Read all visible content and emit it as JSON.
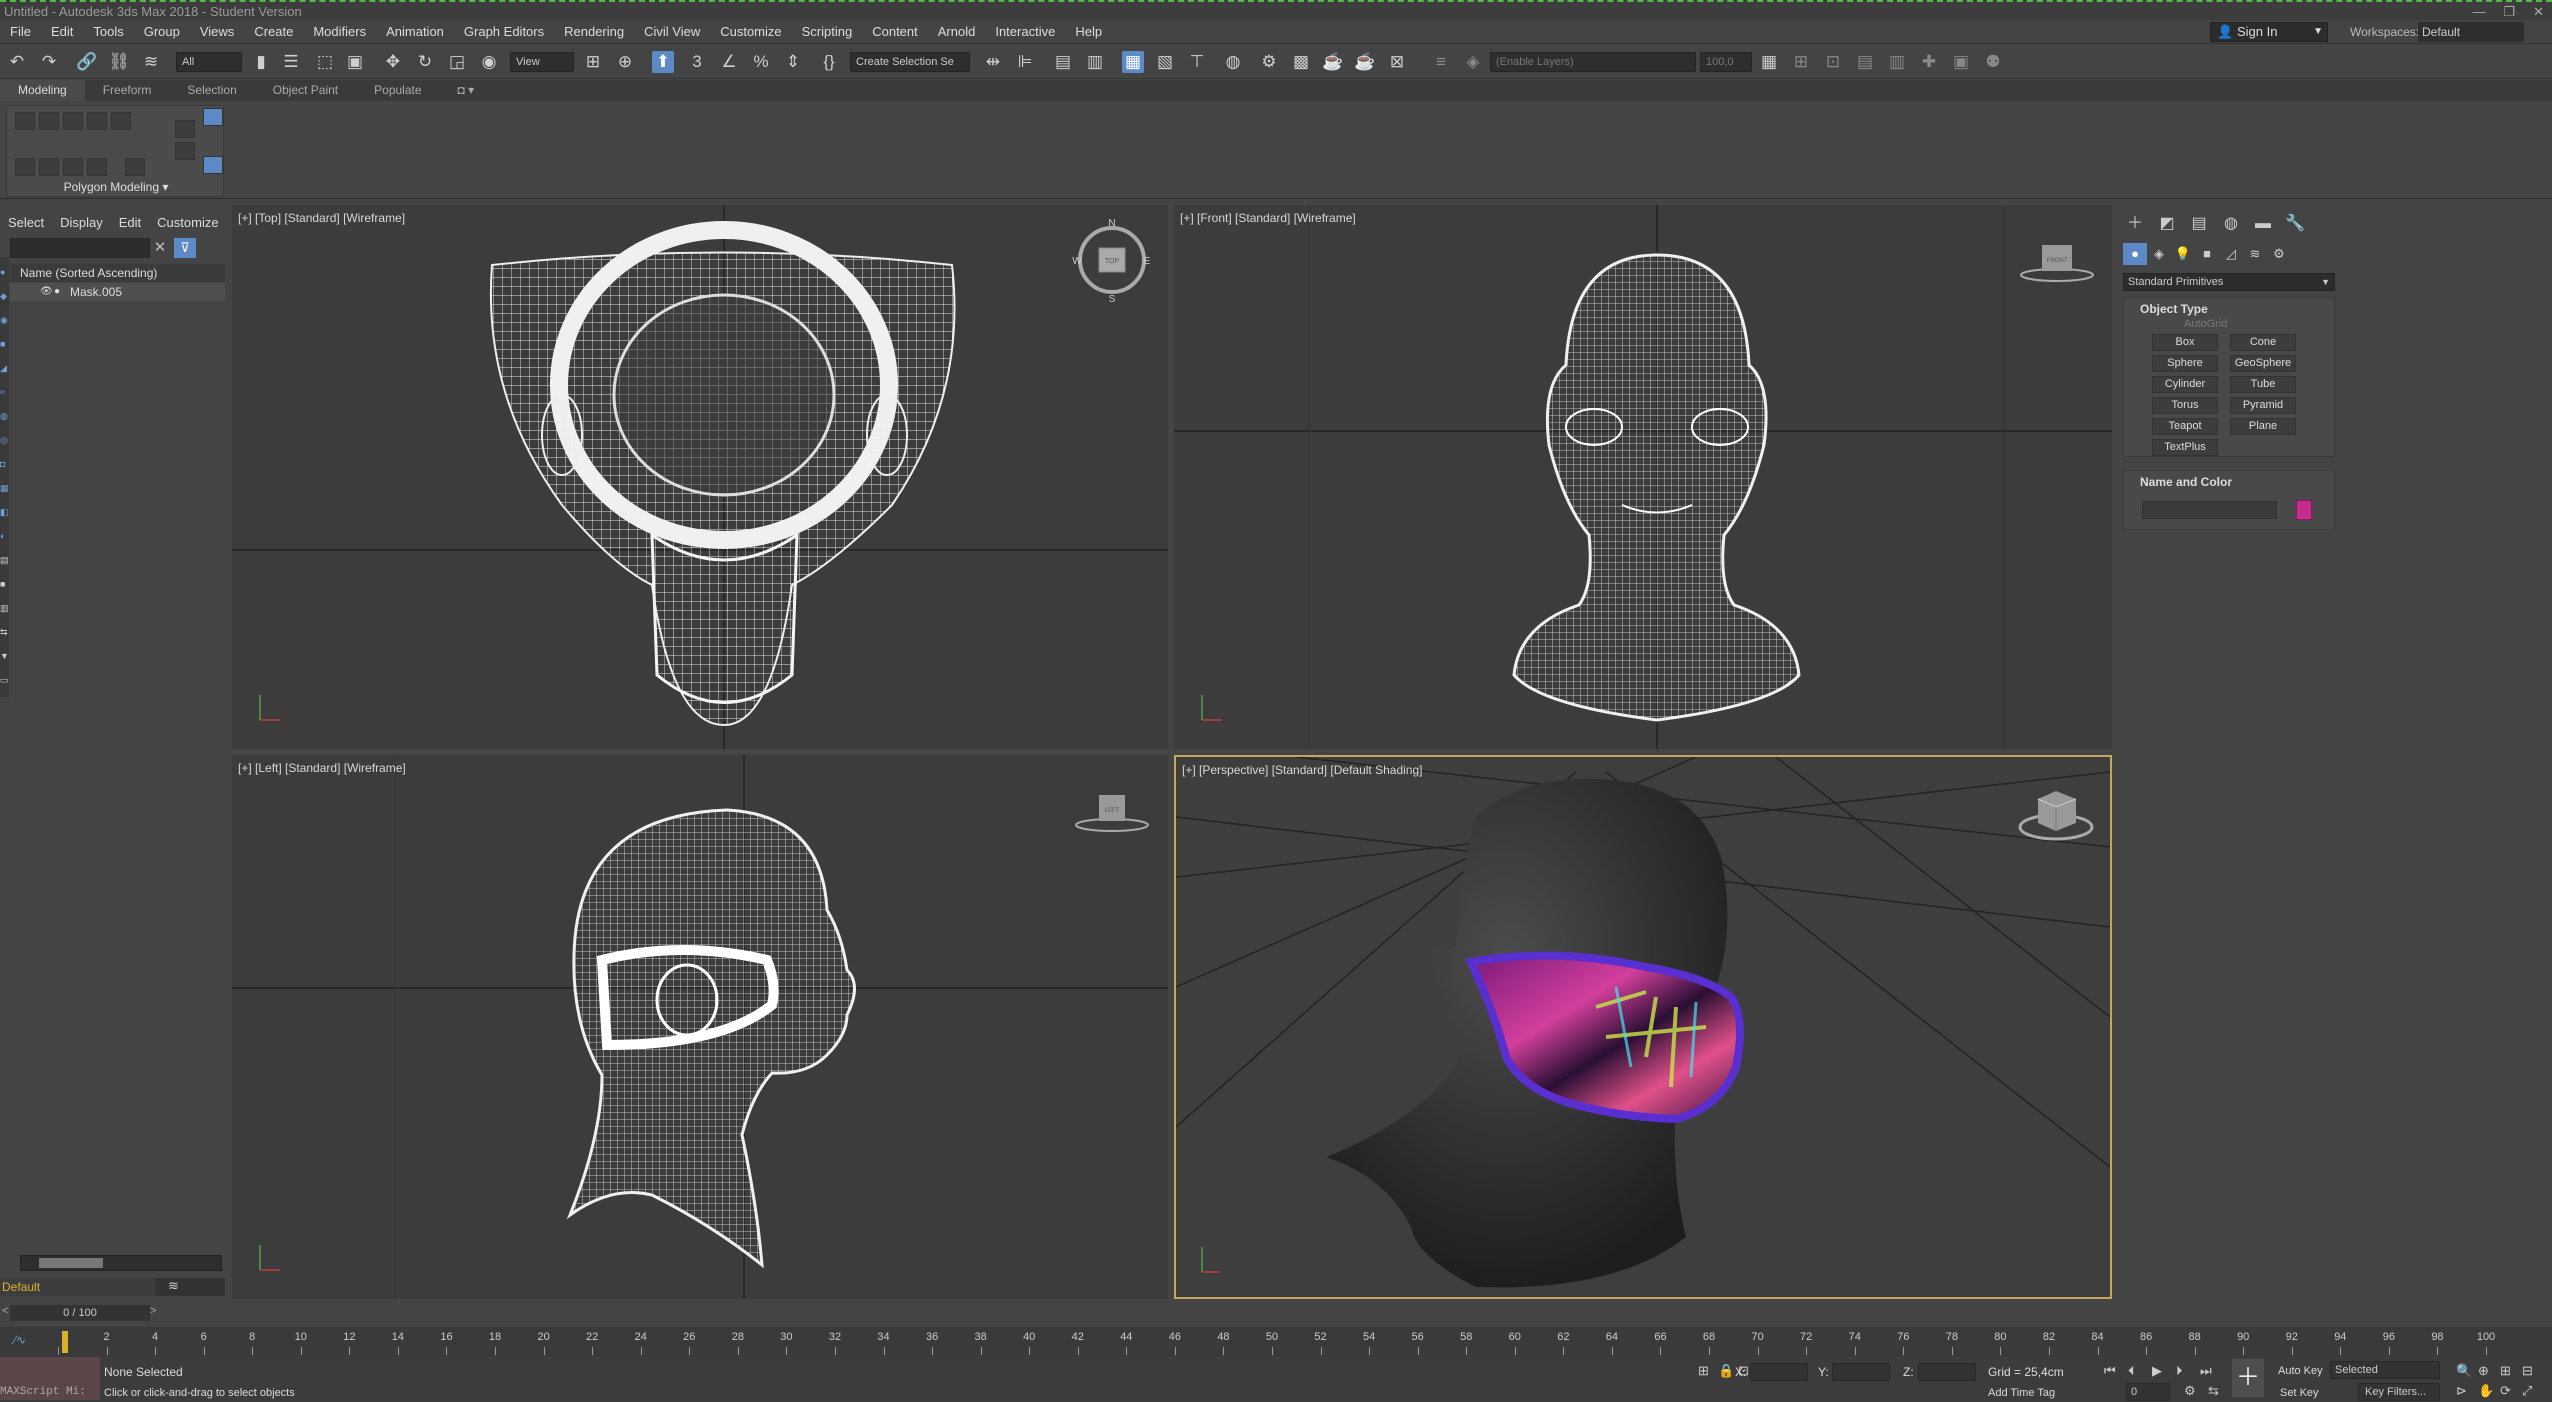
{
  "window": {
    "title": "Untitled - Autodesk 3ds Max 2018 - Student Version",
    "controls": [
      "—",
      "❐",
      "✕"
    ]
  },
  "menu": [
    "File",
    "Edit",
    "Tools",
    "Group",
    "Views",
    "Create",
    "Modifiers",
    "Animation",
    "Graph Editors",
    "Rendering",
    "Civil View",
    "Customize",
    "Scripting",
    "Content",
    "Arnold",
    "Interactive",
    "Help"
  ],
  "account": {
    "sign_in": "Sign In",
    "workspaces_label": "Workspaces:",
    "workspace": "Default"
  },
  "toolbar": {
    "filter": "All",
    "coord_system": "View",
    "named_selection": "Create Selection Se",
    "layer": "(Enable Layers)",
    "spinner": "100,0",
    "icons": [
      "undo-icon",
      "redo-icon",
      "link-icon",
      "unlink-icon",
      "bind-space-warp-icon",
      "select-object-icon",
      "select-by-name-icon",
      "rect-region-icon",
      "window-crossing-icon",
      "move-icon",
      "rotate-icon",
      "scale-icon",
      "place-icon",
      "pivot-icon",
      "snap-3d-icon",
      "angle-snap-icon",
      "percent-snap-icon",
      "spinner-snap-icon",
      "mirror-icon",
      "align-icon",
      "layer-explorer-icon",
      "scene-explorer-icon",
      "material-editor-icon",
      "render-setup-icon",
      "render-icon"
    ]
  },
  "ribbon": {
    "tabs": [
      "Modeling",
      "Freeform",
      "Selection",
      "Object Paint",
      "Populate"
    ],
    "active": "Modeling",
    "panel_label": "Polygon Modeling ▾"
  },
  "scene_explorer": {
    "tabs": [
      "Select",
      "Display",
      "Edit",
      "Customize"
    ],
    "header": "Name (Sorted Ascending)",
    "rows": [
      {
        "name": "Mask.005"
      }
    ],
    "layer": "Default",
    "time_slider": "0 / 100"
  },
  "viewports": [
    {
      "label": "[+] [Top] [Standard] [Wireframe]",
      "view": "top",
      "compass": [
        "N",
        "S",
        "E",
        "W"
      ],
      "cube_label": "TOP"
    },
    {
      "label": "[+] [Front] [Standard] [Wireframe]",
      "view": "front",
      "cube_label": "FRONT"
    },
    {
      "label": "[+] [Left] [Standard] [Wireframe]",
      "view": "left",
      "cube_label": "LEFT"
    },
    {
      "label": "[+] [Perspective] [Standard] [Default Shading]",
      "view": "perspective",
      "active": true
    }
  ],
  "command_panel": {
    "category": "Standard Primitives",
    "object_type_title": "Object Type",
    "autogrid": "AutoGrid",
    "buttons": [
      "Box",
      "Cone",
      "Sphere",
      "GeoSphere",
      "Cylinder",
      "Tube",
      "Torus",
      "Pyramid",
      "Teapot",
      "Plane",
      "TextPlus"
    ],
    "name_color_title": "Name and Color",
    "object_color": "#c32d8b"
  },
  "timeline": {
    "ticks": [
      0,
      2,
      4,
      6,
      8,
      10,
      12,
      14,
      16,
      18,
      20,
      22,
      24,
      26,
      28,
      30,
      32,
      34,
      36,
      38,
      40,
      42,
      44,
      46,
      48,
      50,
      52,
      54,
      56,
      58,
      60,
      62,
      64,
      66,
      68,
      70,
      72,
      74,
      76,
      78,
      80,
      82,
      84,
      86,
      88,
      90,
      92,
      94,
      96,
      98,
      100
    ],
    "current": 0
  },
  "status": {
    "maxscript": "MAXScript Mi:",
    "selection": "None Selected",
    "prompt": "Click or click-and-drag to select objects",
    "x_label": "X:",
    "y_label": "Y:",
    "z_label": "Z:",
    "grid": "Grid = 25,4cm",
    "add_time_tag": "Add Time Tag",
    "auto_key": "Auto Key",
    "set_key": "Set Key",
    "key_mode": "Selected",
    "key_filters": "Key Filters...",
    "frame": "0"
  },
  "colors": {
    "accent": "#5d8ac6",
    "active_border": "#c2a85a",
    "layer_text": "#d9b22c"
  }
}
